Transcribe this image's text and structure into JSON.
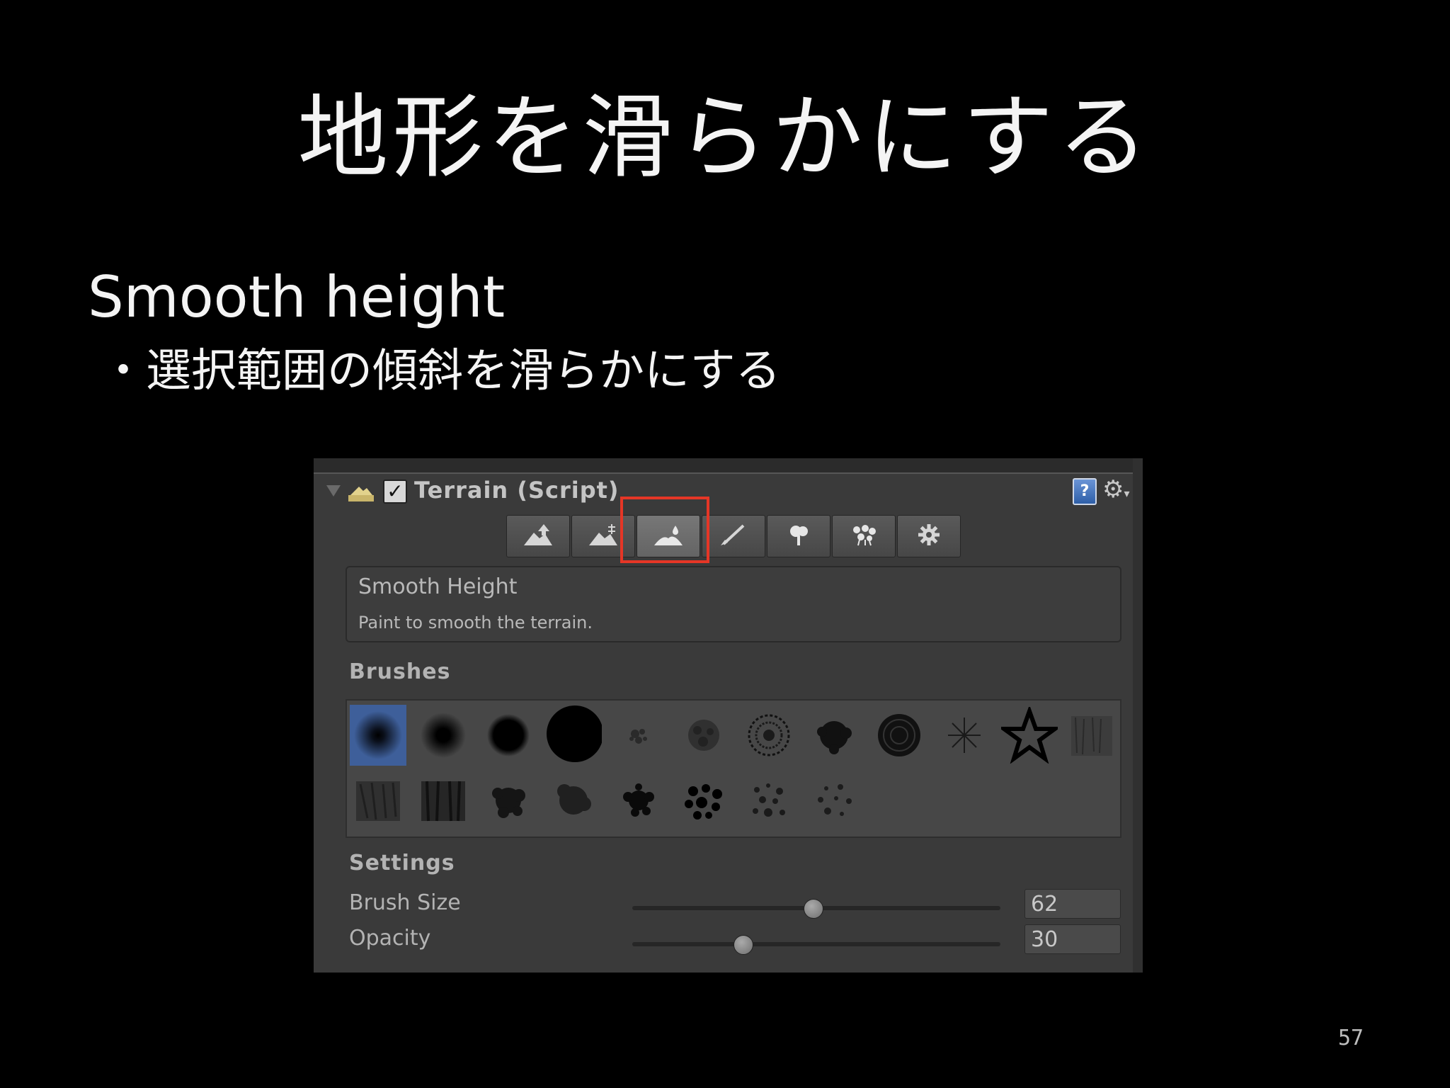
{
  "slide": {
    "title": "地形を滑らかにする",
    "subtitle": "Smooth height",
    "bullet": "・選択範囲の傾斜を滑らかにする",
    "page_number": "57"
  },
  "inspector": {
    "component_name": "Terrain (Script)",
    "component_enabled": true,
    "toolbar": {
      "tools": [
        {
          "name": "raise-lower-terrain-icon",
          "active": false
        },
        {
          "name": "paint-height-icon",
          "active": false
        },
        {
          "name": "smooth-height-icon",
          "active": true
        },
        {
          "name": "paint-texture-icon",
          "active": false
        },
        {
          "name": "place-trees-icon",
          "active": false
        },
        {
          "name": "paint-details-icon",
          "active": false
        },
        {
          "name": "terrain-settings-icon",
          "active": false
        }
      ],
      "highlighted_tool": "smooth-height-icon",
      "highlight_color": "#e53626"
    },
    "description": {
      "title": "Smooth Height",
      "text": "Paint to smooth the terrain."
    },
    "brushes_label": "Brushes",
    "selected_brush_color": "#3e5f9a",
    "settings": {
      "label": "Settings",
      "brush_size": {
        "label": "Brush Size",
        "value": "62",
        "fraction": 0.49
      },
      "opacity": {
        "label": "Opacity",
        "value": "30",
        "fraction": 0.3
      }
    }
  }
}
